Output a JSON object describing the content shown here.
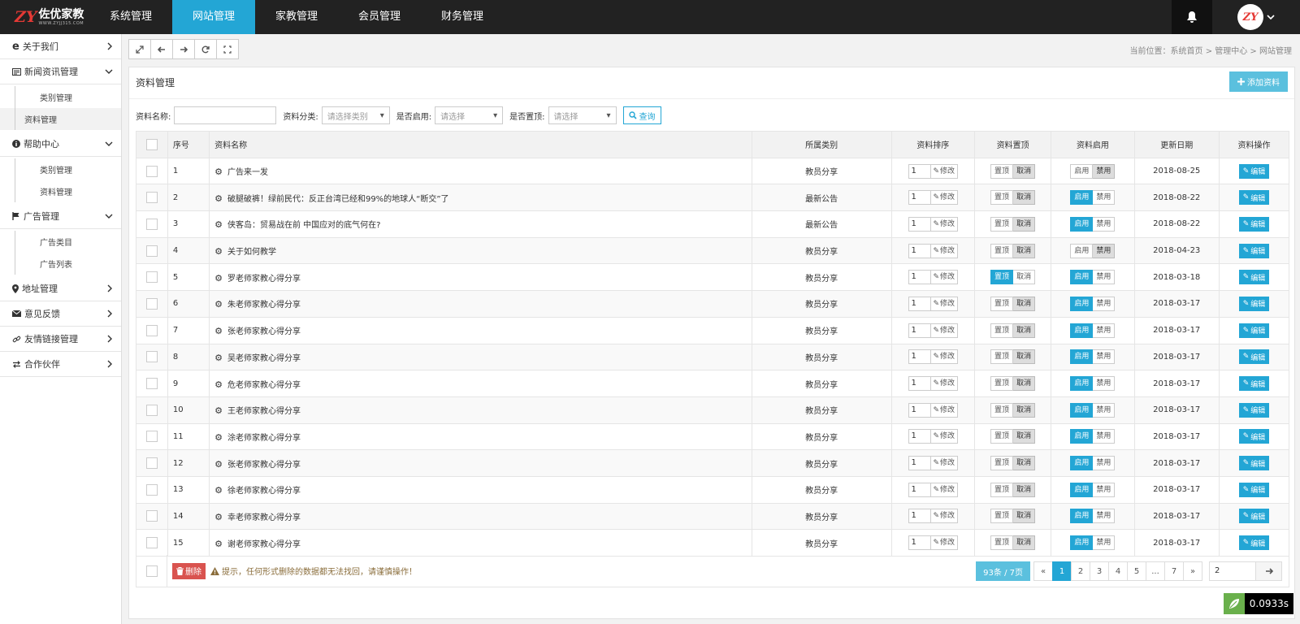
{
  "brand": {
    "mark": "ZY",
    "name": "佐优家教",
    "url": "WWW.ZYJJ315.COM"
  },
  "nav": [
    {
      "label": "系统管理"
    },
    {
      "label": "网站管理",
      "active": true
    },
    {
      "label": "家教管理"
    },
    {
      "label": "会员管理"
    },
    {
      "label": "财务管理"
    }
  ],
  "user": {
    "avatar_text": "ZY"
  },
  "sidebar": {
    "g1": "关于我们",
    "g2": "新闻资讯管理",
    "g2_s1": "类别管理",
    "g2_s2": "资料管理",
    "g3": "帮助中心",
    "g3_s1": "类别管理",
    "g3_s2": "资料管理",
    "g4": "广告管理",
    "g4_s1": "广告类目",
    "g4_s2": "广告列表",
    "g5": "地址管理",
    "g6": "意见反馈",
    "g7": "友情链接管理",
    "g8": "合作伙伴"
  },
  "breadcrumb": "当前位置：系统首页 > 管理中心 > 网站管理",
  "panel": {
    "title": "资料管理",
    "add_label": "添加资料"
  },
  "filters": {
    "name_label": "资料名称:",
    "cat_label": "资料分类:",
    "cat_placeholder": "请选择类别",
    "enable_label": "是否启用:",
    "enable_placeholder": "请选择",
    "top_label": "是否置顶:",
    "top_placeholder": "请选择",
    "search_label": "查询"
  },
  "columns": {
    "seq": "序号",
    "name": "资料名称",
    "cat": "所属类别",
    "sort": "资料排序",
    "top": "资料置顶",
    "enable": "资料启用",
    "date": "更新日期",
    "ops": "资料操作"
  },
  "labels": {
    "modify": "修改",
    "top_on": "置顶",
    "top_off": "取消",
    "en_on": "启用",
    "en_off": "禁用",
    "edit": "编辑"
  },
  "rows": [
    {
      "seq": "1",
      "name": "广告来一发",
      "cat": "教员分享",
      "sort": "1",
      "top": false,
      "enabled": false,
      "date": "2018-08-25"
    },
    {
      "seq": "2",
      "name": "破腿破裤！绿前民代：反正台湾已经和99%的地球人“断交”了",
      "cat": "最新公告",
      "sort": "1",
      "top": false,
      "enabled": true,
      "date": "2018-08-22"
    },
    {
      "seq": "3",
      "name": "侠客岛：贸易战在前 中国应对的底气何在?",
      "cat": "最新公告",
      "sort": "1",
      "top": false,
      "enabled": true,
      "date": "2018-08-22"
    },
    {
      "seq": "4",
      "name": "关于如何教学",
      "cat": "教员分享",
      "sort": "1",
      "top": false,
      "enabled": false,
      "date": "2018-04-23"
    },
    {
      "seq": "5",
      "name": "罗老师家教心得分享",
      "cat": "教员分享",
      "sort": "1",
      "top": true,
      "enabled": true,
      "date": "2018-03-18"
    },
    {
      "seq": "6",
      "name": "朱老师家教心得分享",
      "cat": "教员分享",
      "sort": "1",
      "top": false,
      "enabled": true,
      "date": "2018-03-17"
    },
    {
      "seq": "7",
      "name": "张老师家教心得分享",
      "cat": "教员分享",
      "sort": "1",
      "top": false,
      "enabled": true,
      "date": "2018-03-17"
    },
    {
      "seq": "8",
      "name": "吴老师家教心得分享",
      "cat": "教员分享",
      "sort": "1",
      "top": false,
      "enabled": true,
      "date": "2018-03-17"
    },
    {
      "seq": "9",
      "name": "危老师家教心得分享",
      "cat": "教员分享",
      "sort": "1",
      "top": false,
      "enabled": true,
      "date": "2018-03-17"
    },
    {
      "seq": "10",
      "name": "王老师家教心得分享",
      "cat": "教员分享",
      "sort": "1",
      "top": false,
      "enabled": true,
      "date": "2018-03-17"
    },
    {
      "seq": "11",
      "name": "涂老师家教心得分享",
      "cat": "教员分享",
      "sort": "1",
      "top": false,
      "enabled": true,
      "date": "2018-03-17"
    },
    {
      "seq": "12",
      "name": "张老师家教心得分享",
      "cat": "教员分享",
      "sort": "1",
      "top": false,
      "enabled": true,
      "date": "2018-03-17"
    },
    {
      "seq": "13",
      "name": "徐老师家教心得分享",
      "cat": "教员分享",
      "sort": "1",
      "top": false,
      "enabled": true,
      "date": "2018-03-17"
    },
    {
      "seq": "14",
      "name": "幸老师家教心得分享",
      "cat": "教员分享",
      "sort": "1",
      "top": false,
      "enabled": true,
      "date": "2018-03-17"
    },
    {
      "seq": "15",
      "name": "谢老师家教心得分享",
      "cat": "教员分享",
      "sort": "1",
      "top": false,
      "enabled": true,
      "date": "2018-03-17"
    }
  ],
  "footer": {
    "delete_label": "删除",
    "warning": "提示，任何形式删除的数据都无法找回，请谨慎操作！"
  },
  "pager": {
    "info": "93条 / 7页",
    "prev": "«",
    "pages": [
      "1",
      "2",
      "3",
      "4",
      "5",
      "...",
      "7"
    ],
    "current": "1",
    "next": "»",
    "jump_value": "2"
  },
  "timer": "0.0933s",
  "colors": {
    "accent": "#23a6d5",
    "danger": "#d9534f",
    "topbar": "#222222"
  }
}
